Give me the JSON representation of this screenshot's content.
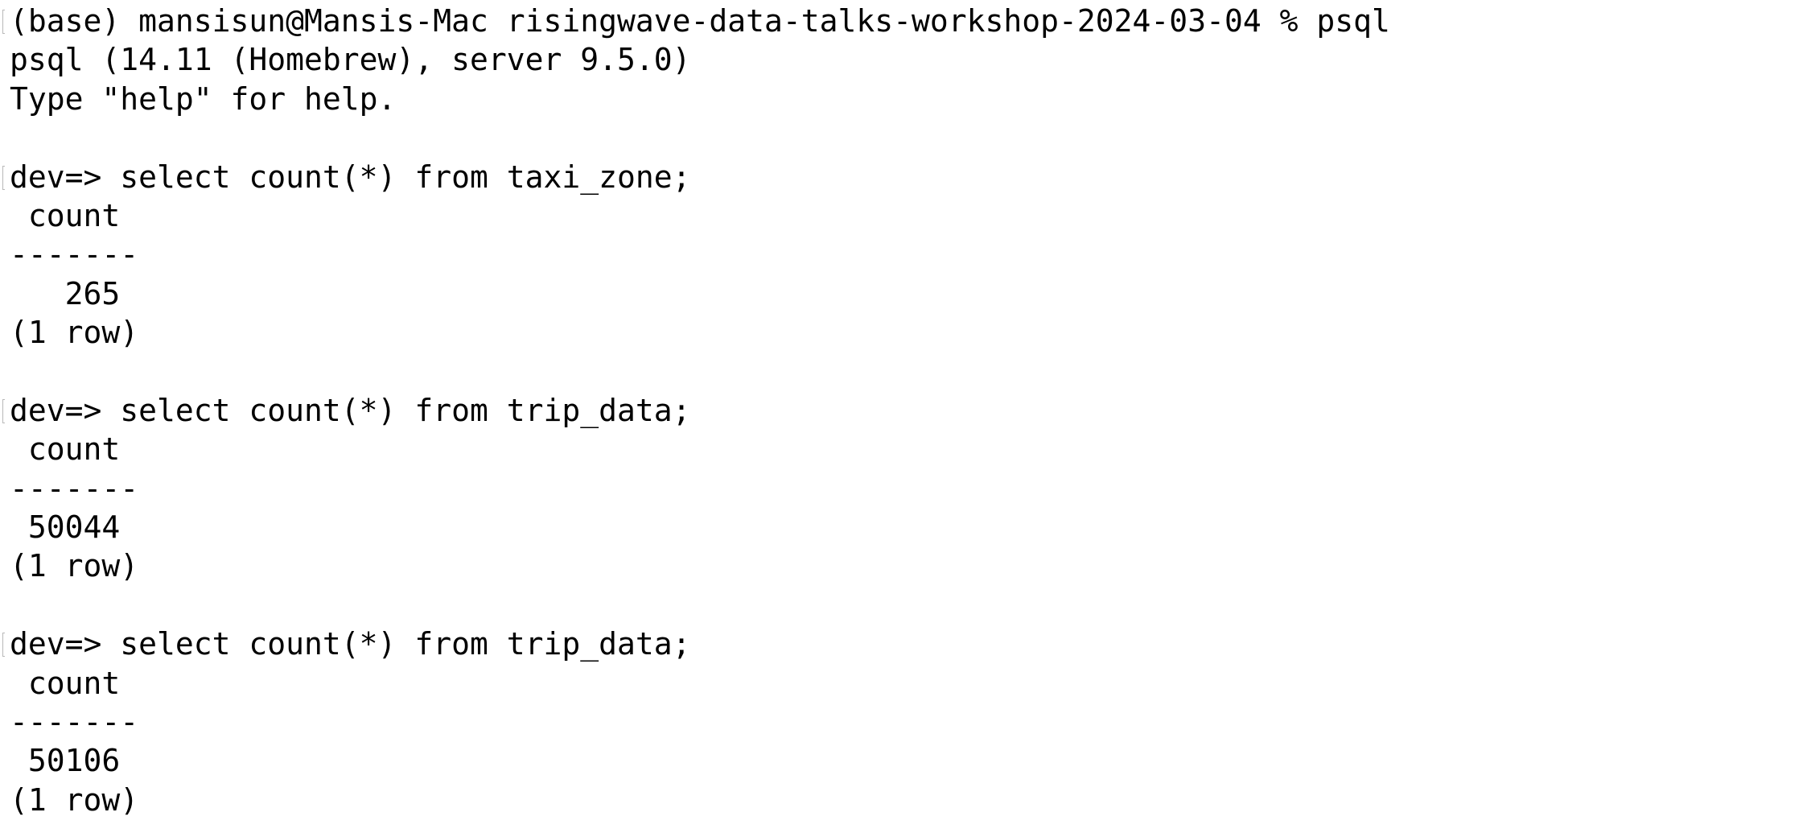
{
  "terminal": {
    "lines": [
      {
        "text": "(base) mansisun@Mansis-Mac risingwave-data-talks-workshop-2024-03-04 % psql",
        "marked": true
      },
      {
        "text": "psql (14.11 (Homebrew), server 9.5.0)",
        "marked": false
      },
      {
        "text": "Type \"help\" for help.",
        "marked": false
      },
      {
        "text": "",
        "marked": false
      },
      {
        "text": "dev=> select count(*) from taxi_zone;",
        "marked": true
      },
      {
        "text": " count",
        "marked": false
      },
      {
        "text": "-------",
        "marked": false
      },
      {
        "text": "   265",
        "marked": false
      },
      {
        "text": "(1 row)",
        "marked": false
      },
      {
        "text": "",
        "marked": false
      },
      {
        "text": "dev=> select count(*) from trip_data;",
        "marked": true
      },
      {
        "text": " count",
        "marked": false
      },
      {
        "text": "-------",
        "marked": false
      },
      {
        "text": " 50044",
        "marked": false
      },
      {
        "text": "(1 row)",
        "marked": false
      },
      {
        "text": "",
        "marked": false
      },
      {
        "text": "dev=> select count(*) from trip_data;",
        "marked": true
      },
      {
        "text": " count",
        "marked": false
      },
      {
        "text": "-------",
        "marked": false
      },
      {
        "text": " 50106",
        "marked": false
      },
      {
        "text": "(1 row)",
        "marked": false
      }
    ]
  }
}
